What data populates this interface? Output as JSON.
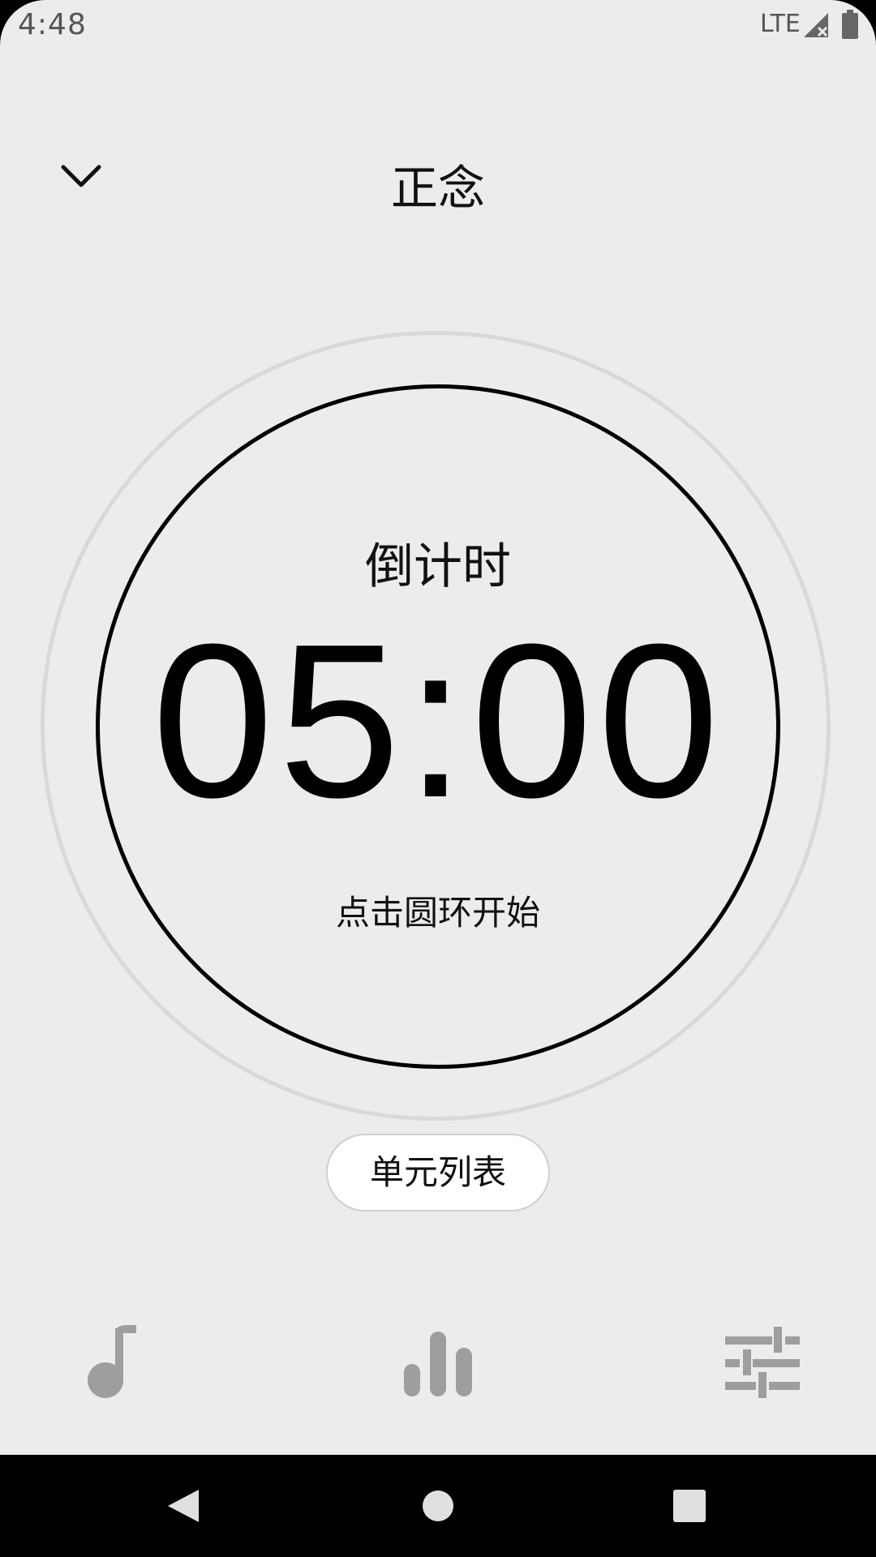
{
  "status_bar": {
    "time": "4:48",
    "network": "LTE",
    "signal_icon": "signal-icon",
    "battery_icon": "battery-icon"
  },
  "header": {
    "back_icon": "chevron-down-icon",
    "title": "正念"
  },
  "timer": {
    "label": "倒计时",
    "value": "05:00",
    "hint": "点击圆环开始"
  },
  "unit_list_button": {
    "label": "单元列表"
  },
  "toolbar": {
    "items": [
      {
        "icon": "music-note-icon"
      },
      {
        "icon": "bar-chart-icon"
      },
      {
        "icon": "sliders-icon"
      }
    ]
  },
  "navigation_bar": {
    "items": [
      {
        "icon": "back-triangle-icon"
      },
      {
        "icon": "home-circle-icon"
      },
      {
        "icon": "recents-square-icon"
      }
    ]
  },
  "colors": {
    "background": "#ececec",
    "text": "#111111",
    "icon_gray": "#9e9e9e",
    "outer_ring": "#d9d9d9"
  }
}
